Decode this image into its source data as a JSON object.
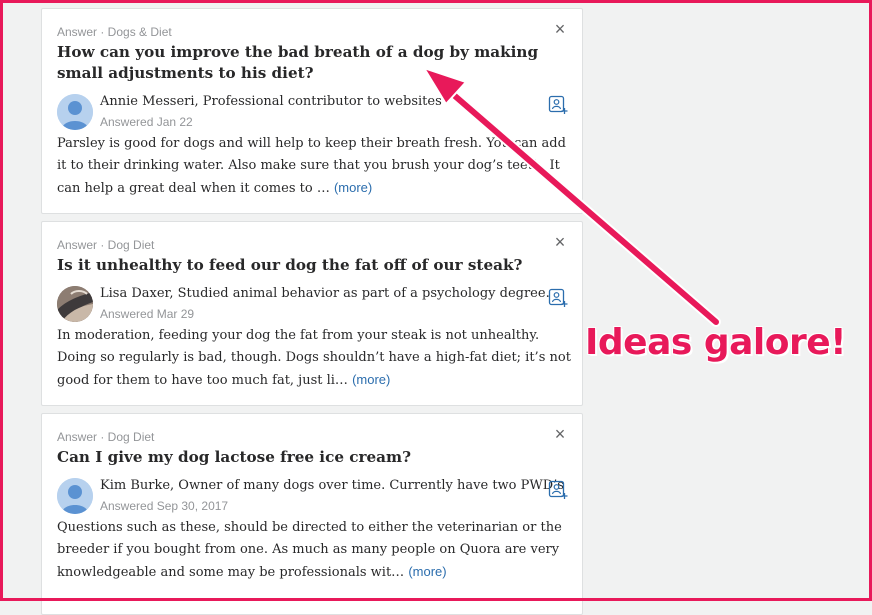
{
  "cards": [
    {
      "meta": "Answer · Dogs & Diet",
      "question": "How can you improve the bad breath of a dog by making small adjustments to his diet?",
      "author": "Annie Messeri, Professional contributor to websites",
      "date": "Answered Jan 22",
      "body": "Parsley is good for dogs and will help to keep their breath fresh. You can add it to their drinking water. Also make sure that you brush your dog’s teeth. It can help a great deal when it comes to …",
      "more": "(more)",
      "avatar": "person-silhouette"
    },
    {
      "meta": "Answer · Dog Diet",
      "question": "Is it unhealthy to feed our dog the fat off of our steak?",
      "author": "Lisa Daxer, Studied animal behavior as part of a psychology degree.",
      "date": "Answered Mar 29",
      "body": "In moderation, feeding your dog the fat from your steak is not unhealthy. Doing so regularly is bad, though. Dogs shouldn’t have a high-fat diet; it’s not good for them to have too much fat, just li…",
      "more": "(more)",
      "avatar": "photo"
    },
    {
      "meta": "Answer · Dog Diet",
      "question": "Can I give my dog lactose free ice cream?",
      "author": "Kim Burke, Owner of many dogs over time. Currently have two PWD’s",
      "date": "Answered Sep 30, 2017",
      "body": "Questions such as these, should be directed to either the veterinarian or the breeder if you bought from one. As much as many people on Quora are very knowledgeable and some may be professionals wit…",
      "more": "(more)",
      "avatar": "person-silhouette"
    }
  ],
  "close_symbol": "×",
  "annotation": "Ideas galore!",
  "colors": {
    "annotation": "#e8195a",
    "link": "#2b6dad",
    "follow_icon": "#2b6dad"
  }
}
